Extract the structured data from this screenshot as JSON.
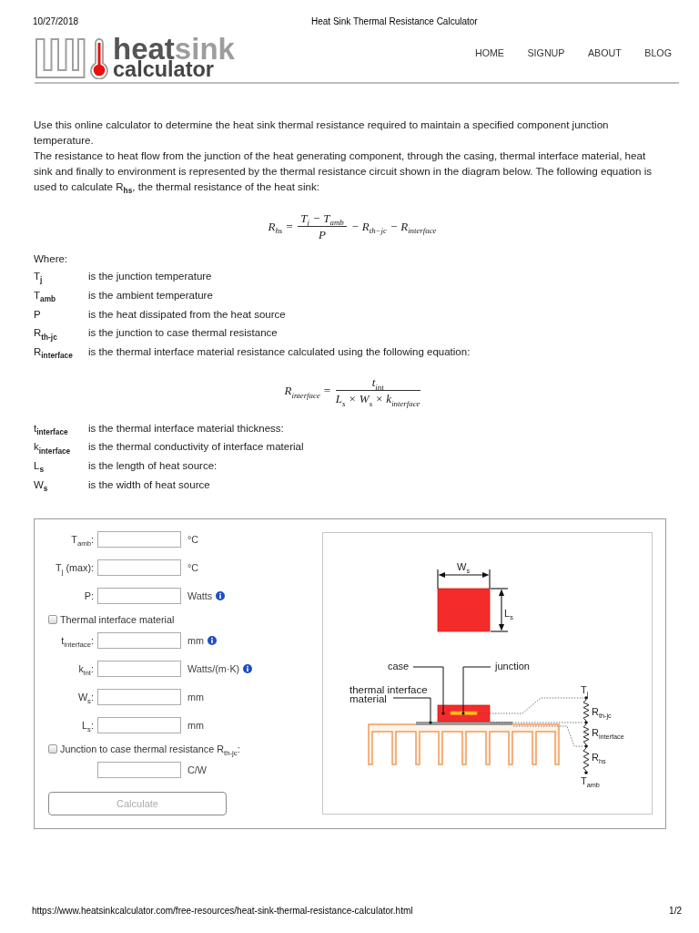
{
  "print_header": {
    "date": "10/27/2018",
    "title": "Heat Sink Thermal Resistance Calculator"
  },
  "logo": {
    "title": [
      {
        "text": "heat",
        "kind": "dark"
      },
      {
        "text": "sink",
        "kind": "light"
      }
    ],
    "subtitle": "calculator"
  },
  "nav": [
    "HOME",
    "SIGNUP",
    "ABOUT",
    "BLOG"
  ],
  "intro": [
    "Use this online calculator to determine the heat sink thermal resistance required to maintain a specified component junction temperature.",
    "The resistance to heat flow from the junction of the heat generating component, through the casing, thermal interface material, heat sink and finally to environment is represented by the thermal resistance circuit shown in the diagram below. The following equation is used to calculate R$_{hs}$, the thermal resistance of the heat sink:"
  ],
  "equation": {
    "lhs": "R$_{hs}$ =",
    "numerator": "T$_{j}$ − T$_{amb}$",
    "denominator": "P",
    "rest": "− R$_{th−jc}$ − R$_{interface}$"
  },
  "where_label": "Where:",
  "terms": [
    {
      "symbol": "T$_{j}$",
      "meaning": "is the junction temperature"
    },
    {
      "symbol": "T$_{amb}$",
      "meaning": "is the ambient temperature"
    },
    {
      "symbol": "P",
      "meaning": "is the heat dissipated from the heat source"
    },
    {
      "symbol": "R$_{th-jc}$",
      "meaning": "is the junction to case thermal resistance"
    },
    {
      "symbol": "R$_{interface}$",
      "meaning": "is the thermal interface material resistance calculated using the following equation:"
    }
  ],
  "interface_equation": {
    "lhs": "R$_{interface}$ =",
    "numerator": "t$_{int}$",
    "denominator": "L$_{s}$ × W$_{s}$ × k$_{interface}$"
  },
  "interface_terms": [
    {
      "symbol": "t$_{interface}$",
      "meaning": "is the thermal interface material thickness:"
    },
    {
      "symbol": "k$_{interface}$",
      "meaning": "is the thermal conductivity of interface material"
    },
    {
      "symbol": "L$_{s}$",
      "meaning": "is the length of heat source:"
    },
    {
      "symbol": "W$_{s}$",
      "meaning": "is the width of heat source"
    }
  ],
  "calculator": {
    "rows": [
      {
        "kind": "field",
        "label": "T$_{amb}$:",
        "unit": "°C"
      },
      {
        "kind": "field",
        "label": "T$_{j}$ (max):",
        "unit": "°C"
      },
      {
        "kind": "field",
        "label": "P:",
        "unit": "Watts",
        "info": true
      },
      {
        "kind": "checkbox",
        "label": "Thermal interface material",
        "checked": false
      },
      {
        "kind": "field",
        "label": "t$_{interface}$:",
        "unit": "mm",
        "info": true
      },
      {
        "kind": "field",
        "label": "k$_{int}$:",
        "unit": "Watts/(m·K)",
        "info": true
      },
      {
        "kind": "field",
        "label": "W$_{s}$:",
        "unit": "mm"
      },
      {
        "kind": "field",
        "label": "L$_{s}$:",
        "unit": "mm"
      },
      {
        "kind": "checkbox",
        "label": "Junction to case thermal resistance R$_{th-jc}$:",
        "checked": false
      },
      {
        "kind": "field",
        "unit": "C/W"
      }
    ],
    "button": {
      "label": "Calculate",
      "disabled": true
    },
    "diagram": {
      "width_label": "W$_{s}$",
      "length_label": "L$_{s}$",
      "case_label": "case",
      "junction_label": "junction",
      "interface_label": "thermal interface material",
      "top_node": "T$_{j}$",
      "resistors": [
        "R$_{th-jc}$",
        "R$_{interface}$",
        "R$_{hs}$"
      ],
      "bottom_node": "T$_{amb}$"
    }
  },
  "footer": {
    "url": "https://www.heatsinkcalculator.com/free-resources/heat-sink-thermal-resistance-calculator.html",
    "page": "1/2"
  }
}
